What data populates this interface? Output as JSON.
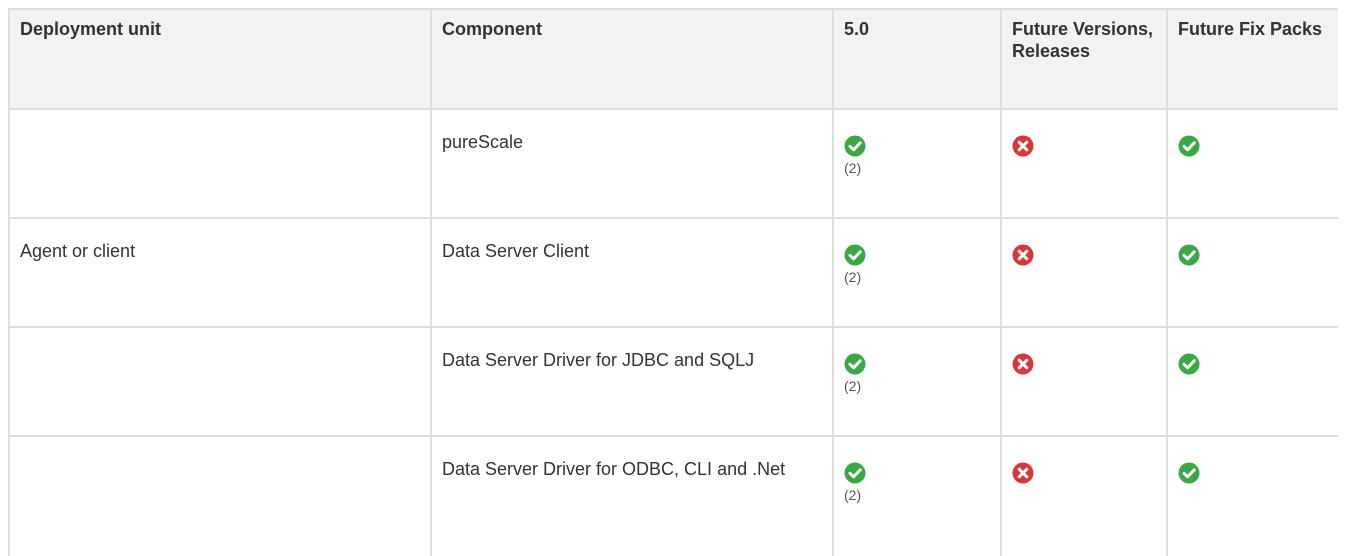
{
  "table": {
    "headers": [
      "Deployment unit",
      "Component",
      "5.0",
      "Future Versions, Releases",
      "Future Fix Packs"
    ],
    "rows": [
      {
        "deployment_unit": "",
        "component": "pureScale",
        "v50": {
          "status": "supported",
          "icon": "check-icon",
          "note": "(2)"
        },
        "future_versions": {
          "status": "not-supported",
          "icon": "cross-icon"
        },
        "future_fix_packs": {
          "status": "supported",
          "icon": "check-icon"
        }
      },
      {
        "deployment_unit": "Agent or client",
        "component": "Data Server Client",
        "v50": {
          "status": "supported",
          "icon": "check-icon",
          "note": "(2)"
        },
        "future_versions": {
          "status": "not-supported",
          "icon": "cross-icon"
        },
        "future_fix_packs": {
          "status": "supported",
          "icon": "check-icon"
        }
      },
      {
        "deployment_unit": "",
        "component": "Data Server Driver for JDBC and SQLJ",
        "v50": {
          "status": "supported",
          "icon": "check-icon",
          "note": "(2)"
        },
        "future_versions": {
          "status": "not-supported",
          "icon": "cross-icon"
        },
        "future_fix_packs": {
          "status": "supported",
          "icon": "check-icon"
        }
      },
      {
        "deployment_unit": "",
        "component": "Data Server Driver for ODBC, CLI and .Net",
        "v50": {
          "status": "supported",
          "icon": "check-icon",
          "note": "(2)"
        },
        "future_versions": {
          "status": "not-supported",
          "icon": "cross-icon"
        },
        "future_fix_packs": {
          "status": "supported",
          "icon": "check-icon"
        }
      }
    ]
  },
  "colors": {
    "supported": "#3aa845",
    "not_supported": "#d9383a",
    "header_bg": "#f2f2f2",
    "border": "#dddddd",
    "text": "#333333"
  }
}
